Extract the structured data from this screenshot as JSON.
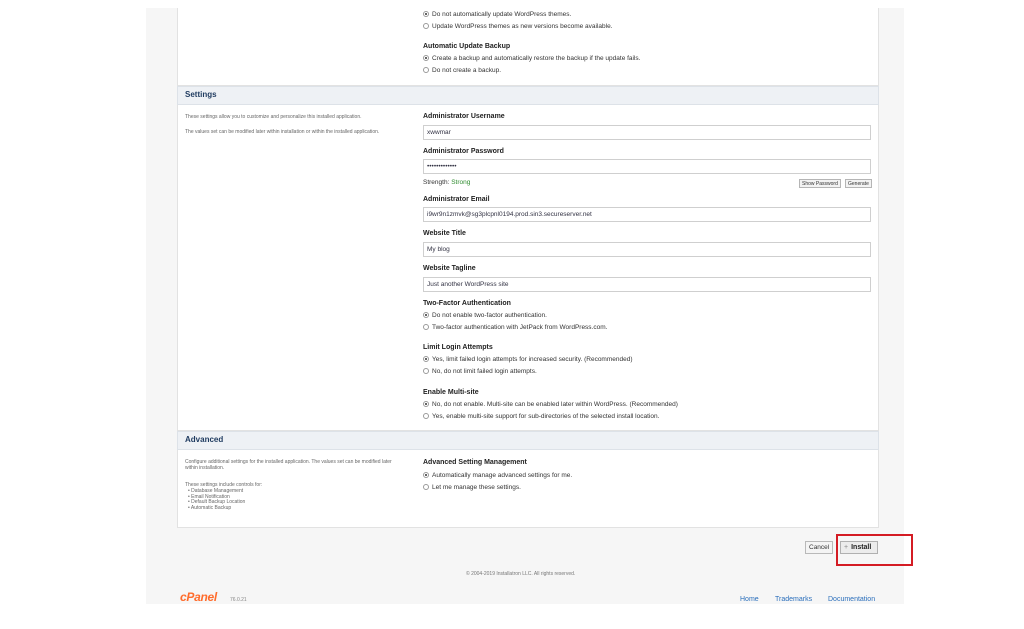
{
  "top_section": {
    "theme_options": [
      {
        "label": "Do not automatically update WordPress themes.",
        "checked": true
      },
      {
        "label": "Update WordPress themes as new versions become available.",
        "checked": false
      }
    ],
    "backup_title": "Automatic Update Backup",
    "backup_options": [
      {
        "label": "Create a backup and automatically restore the backup if the update fails.",
        "checked": true
      },
      {
        "label": "Do not create a backup.",
        "checked": false
      }
    ]
  },
  "settings": {
    "header": "Settings",
    "desc1": "These settings allow you to customize and personalize this installed application.",
    "desc2": "The values set can be modified later within installation or within the installed application.",
    "admin_username_label": "Administrator Username",
    "admin_username_value": "xwwmar",
    "admin_password_label": "Administrator Password",
    "admin_password_value": "•••••••••••••",
    "strength_label": "Strength:",
    "strength_value": "Strong",
    "show_password_label": "Show Password",
    "generate_label": "Generate",
    "admin_email_label": "Administrator Email",
    "admin_email_value": "i9wr9n1zmvk@sg3plcpnl0194.prod.sin3.secureserver.net",
    "website_title_label": "Website Title",
    "website_title_value": "My blog",
    "website_tagline_label": "Website Tagline",
    "website_tagline_value": "Just another WordPress site",
    "tfa_label": "Two-Factor Authentication",
    "tfa_options": [
      {
        "label": "Do not enable two-factor authentication.",
        "checked": true
      },
      {
        "label": "Two-factor authentication with JetPack from WordPress.com.",
        "checked": false
      }
    ],
    "limit_label": "Limit Login Attempts",
    "limit_options": [
      {
        "label": "Yes, limit failed login attempts for increased security. (Recommended)",
        "checked": true
      },
      {
        "label": "No, do not limit failed login attempts.",
        "checked": false
      }
    ],
    "multisite_label": "Enable Multi-site",
    "multisite_options": [
      {
        "label": "No, do not enable. Multi-site can be enabled later within WordPress. (Recommended)",
        "checked": true
      },
      {
        "label": "Yes, enable multi-site support for sub-directories of the selected install location.",
        "checked": false
      }
    ]
  },
  "advanced": {
    "header": "Advanced",
    "desc1": "Configure additional settings for the installed application. The values set can be modified later within installation.",
    "desc2": "These settings include controls for:",
    "bullets": [
      "Database Management",
      "Email Notification",
      "Default Backup Location",
      "Automatic Backup"
    ],
    "asm_label": "Advanced Setting Management",
    "asm_options": [
      {
        "label": "Automatically manage advanced settings for me.",
        "checked": true
      },
      {
        "label": "Let me manage these settings.",
        "checked": false
      }
    ]
  },
  "actions": {
    "cancel_label": "Cancel",
    "install_label": "Install"
  },
  "footer": {
    "copyright": "© 2004-2019 Installatron LLC. All rights reserved.",
    "logo_text": "cPanel",
    "version": "76.0.21",
    "links": [
      "Home",
      "Trademarks",
      "Documentation"
    ]
  },
  "colors": {
    "accent_link": "#2a6ebb",
    "strength_good": "#2e8b2e",
    "highlight_box": "#d41c24",
    "brand_orange": "#ff6c2c"
  }
}
